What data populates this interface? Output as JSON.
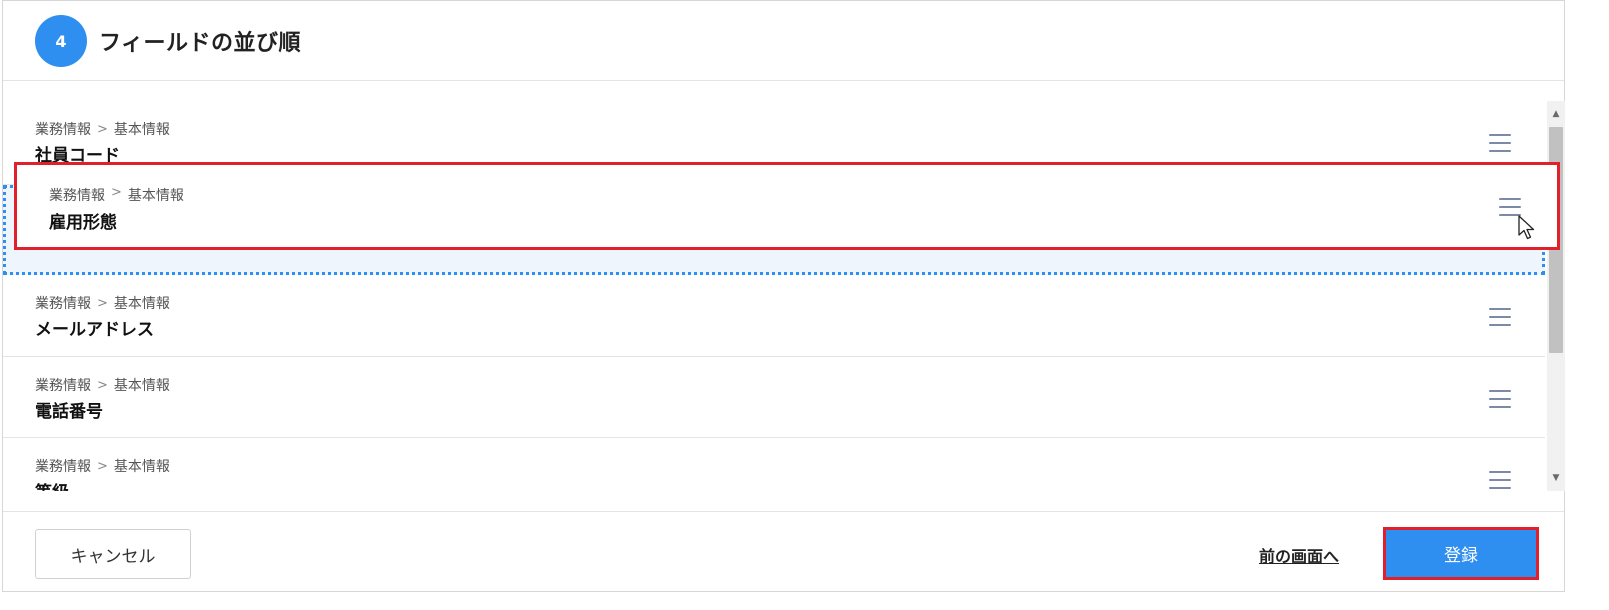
{
  "header": {
    "step_number": "4",
    "title": "フィールドの並び順"
  },
  "breadcrumb": {
    "parent": "業務情報",
    "separator": ">",
    "child": "基本情報"
  },
  "rows": [
    {
      "name": "社員コード"
    },
    {
      "name": "メールアドレス"
    },
    {
      "name": "電話番号"
    },
    {
      "name": "等級"
    }
  ],
  "dragging_item": {
    "name": "雇用形態"
  },
  "icons": {
    "drag_handle": "drag-handle-icon",
    "cursor": "mouse-pointer-icon",
    "scroll_up": "chevron-up-icon",
    "scroll_down": "chevron-down-icon"
  },
  "footer": {
    "cancel_label": "キャンセル",
    "back_label": "前の画面へ",
    "register_label": "登録"
  },
  "colors": {
    "primary": "#2e8ff0",
    "highlight": "#e0202a",
    "drop_zone_bg": "#eef5fd"
  }
}
